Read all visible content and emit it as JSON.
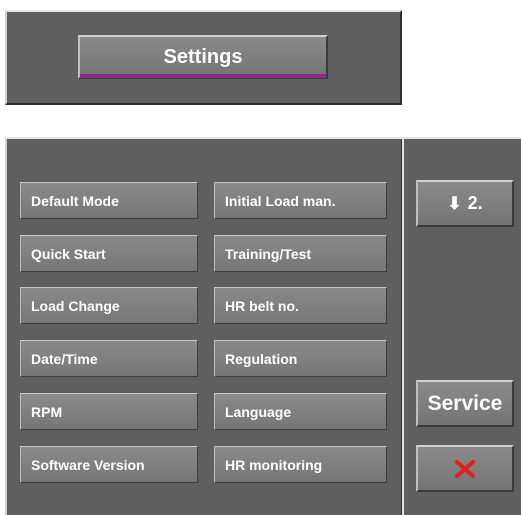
{
  "header": {
    "title": "Settings",
    "accent_color": "#8a2a8a"
  },
  "menu": {
    "left_column": [
      {
        "label": "Default Mode"
      },
      {
        "label": "Quick Start"
      },
      {
        "label": "Load Change"
      },
      {
        "label": "Date/Time"
      },
      {
        "label": "RPM"
      },
      {
        "label": "Software Version"
      }
    ],
    "right_column": [
      {
        "label": "Initial Load man."
      },
      {
        "label": "Training/Test"
      },
      {
        "label": "HR belt no."
      },
      {
        "label": "Regulation"
      },
      {
        "label": "Language"
      },
      {
        "label": "HR monitoring"
      }
    ]
  },
  "side": {
    "page_arrow_icon": "down-arrow-icon",
    "page_label": "2.",
    "service_label": "Service",
    "close_icon": "close-x-icon",
    "close_color": "#e02020"
  }
}
